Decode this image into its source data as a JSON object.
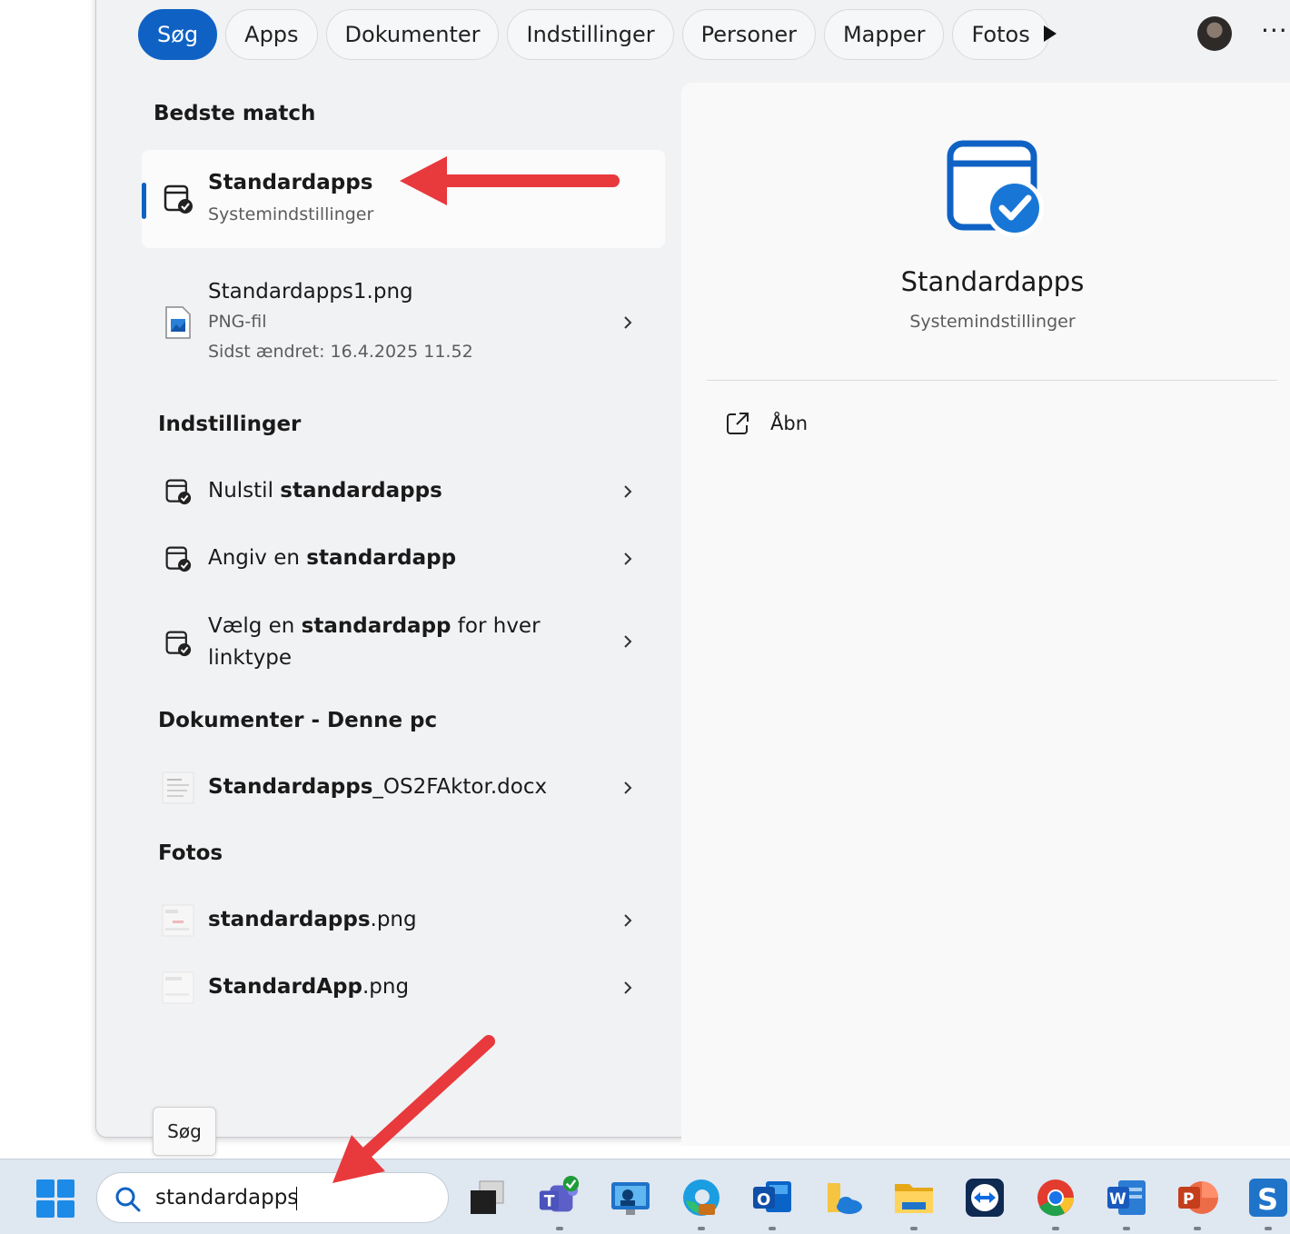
{
  "filter_tabs": [
    {
      "label": "Søg",
      "active": true
    },
    {
      "label": "Apps"
    },
    {
      "label": "Dokumenter"
    },
    {
      "label": "Indstillinger"
    },
    {
      "label": "Personer"
    },
    {
      "label": "Mapper"
    },
    {
      "label": "Fotos"
    }
  ],
  "sections": {
    "best_match": "Bedste match",
    "settings": "Indstillinger",
    "documents": "Dokumenter - Denne pc",
    "photos": "Fotos"
  },
  "best_match": {
    "title": "Standardapps",
    "subtitle": "Systemindstillinger"
  },
  "png_result": {
    "title": "Standardapps1.png",
    "type": "PNG-fil",
    "modified": "Sidst ændret: 16.4.2025 11.52"
  },
  "settings_results": [
    {
      "prefix": "Nulstil ",
      "bold": "standardapps",
      "suffix": ""
    },
    {
      "prefix": "Angiv en ",
      "bold": "standardapp",
      "suffix": ""
    },
    {
      "prefix": "Vælg en ",
      "bold": "standardapp",
      "suffix": " for hver",
      "line2": "linktype"
    }
  ],
  "document_results": [
    {
      "bold": "Standardapps",
      "suffix": "_OS2FAktor.docx"
    }
  ],
  "photo_results": [
    {
      "bold": "standardapps",
      "suffix": ".png"
    },
    {
      "bold": "StandardApp",
      "suffix": ".png"
    }
  ],
  "preview": {
    "title": "Standardapps",
    "subtitle": "Systemindstillinger",
    "open_label": "Åbn"
  },
  "tooltip": "Søg",
  "taskbar": {
    "search_query": "standardapps",
    "apps": [
      "task-view",
      "teams",
      "remote-desktop",
      "edge",
      "outlook",
      "onedrive-folder",
      "file-explorer",
      "teamviewer",
      "chrome",
      "word",
      "powerpoint",
      "s-app"
    ]
  },
  "colors": {
    "accent": "#0f62c4",
    "annotation_arrow": "#e8393d",
    "panel": "#f1f2f4"
  }
}
